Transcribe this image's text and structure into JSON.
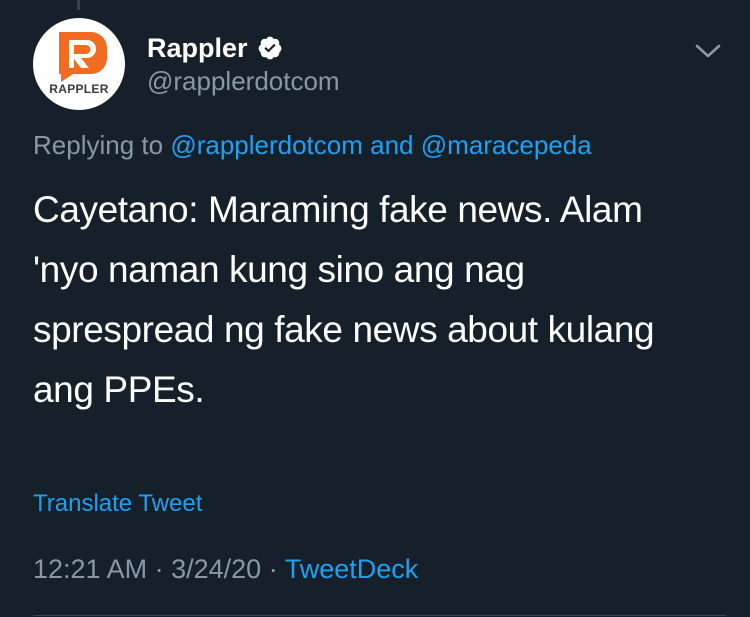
{
  "account": {
    "display_name": "Rappler",
    "handle": "@rapplerdotcom",
    "avatar_label": "RAPPLER",
    "verified": true,
    "brand_color": "#f26b21"
  },
  "reply": {
    "prefix": "Replying to",
    "mentions": [
      "@rapplerdotcom",
      "@maracepeda"
    ],
    "conjunction": "and"
  },
  "tweet": {
    "text": "Cayetano: Maraming fake news. Alam 'nyo naman kung sino ang nag sprespread ng fake news about kulang ang PPEs."
  },
  "translate_label": "Translate Tweet",
  "meta": {
    "time": "12:21 AM",
    "separator": "·",
    "date": "3/24/20",
    "source": "TweetDeck"
  },
  "icons": {
    "verified": "verified-badge-icon",
    "more": "chevron-down-icon"
  },
  "colors": {
    "background": "#15202b",
    "text": "#ffffff",
    "secondary": "#8899a6",
    "link": "#1da1f2",
    "border": "#38444d"
  }
}
